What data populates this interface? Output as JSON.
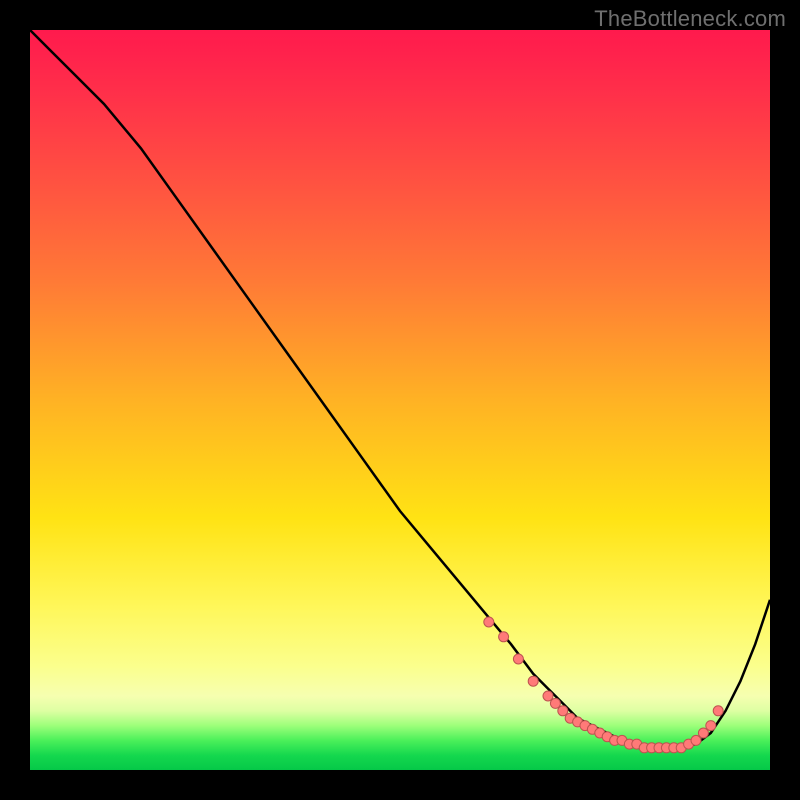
{
  "watermark": "TheBottleneck.com",
  "colors": {
    "frame": "#000000",
    "curve_stroke": "#000000",
    "marker_fill": "#ff7a78",
    "marker_stroke": "#bd5450"
  },
  "chart_data": {
    "type": "line",
    "title": "",
    "xlabel": "",
    "ylabel": "",
    "xlim": [
      0,
      100
    ],
    "ylim": [
      0,
      100
    ],
    "grid": false,
    "legend": false,
    "series": [
      {
        "name": "curve",
        "x": [
          0,
          3,
          6,
          10,
          15,
          20,
          25,
          30,
          35,
          40,
          45,
          50,
          55,
          60,
          65,
          68,
          70,
          72,
          74,
          76,
          78,
          80,
          82,
          84,
          86,
          88,
          90,
          92,
          94,
          96,
          98,
          100
        ],
        "y": [
          100,
          97,
          94,
          90,
          84,
          77,
          70,
          63,
          56,
          49,
          42,
          35,
          29,
          23,
          17,
          13,
          11,
          9,
          7,
          6,
          5,
          4,
          3.5,
          3,
          3,
          3,
          3.5,
          5,
          8,
          12,
          17,
          23
        ]
      }
    ],
    "markers": [
      {
        "x": 62,
        "y": 20
      },
      {
        "x": 64,
        "y": 18
      },
      {
        "x": 66,
        "y": 15
      },
      {
        "x": 68,
        "y": 12
      },
      {
        "x": 70,
        "y": 10
      },
      {
        "x": 71,
        "y": 9
      },
      {
        "x": 72,
        "y": 8
      },
      {
        "x": 73,
        "y": 7
      },
      {
        "x": 74,
        "y": 6.5
      },
      {
        "x": 75,
        "y": 6
      },
      {
        "x": 76,
        "y": 5.5
      },
      {
        "x": 77,
        "y": 5
      },
      {
        "x": 78,
        "y": 4.5
      },
      {
        "x": 79,
        "y": 4
      },
      {
        "x": 80,
        "y": 4
      },
      {
        "x": 81,
        "y": 3.5
      },
      {
        "x": 82,
        "y": 3.5
      },
      {
        "x": 83,
        "y": 3
      },
      {
        "x": 84,
        "y": 3
      },
      {
        "x": 85,
        "y": 3
      },
      {
        "x": 86,
        "y": 3
      },
      {
        "x": 87,
        "y": 3
      },
      {
        "x": 88,
        "y": 3
      },
      {
        "x": 89,
        "y": 3.5
      },
      {
        "x": 90,
        "y": 4
      },
      {
        "x": 91,
        "y": 5
      },
      {
        "x": 92,
        "y": 6
      },
      {
        "x": 93,
        "y": 8
      }
    ]
  }
}
